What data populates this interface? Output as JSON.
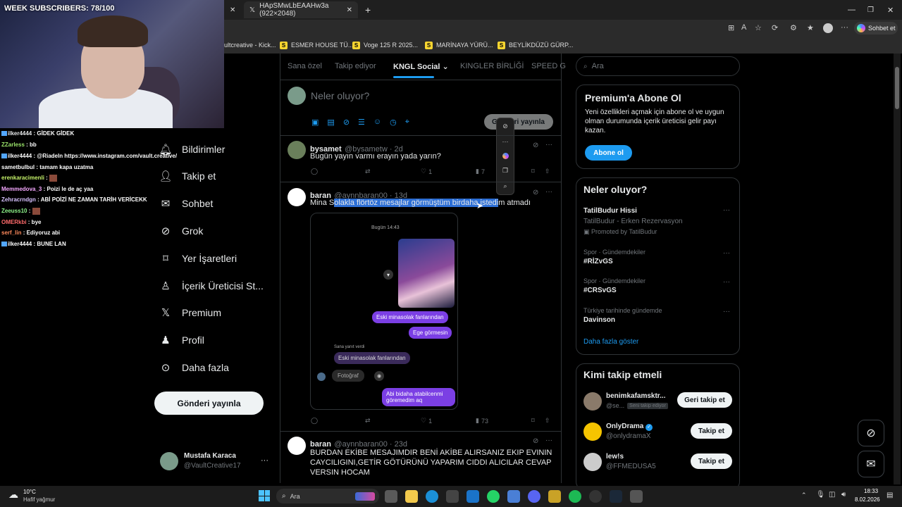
{
  "overlay": {
    "subscribers": "WEEK SUBSCRIBERS: 78/100",
    "chat": [
      {
        "user": "ilker4444",
        "text": ": GİDEK GİDEK",
        "color": "#e7e9ea"
      },
      {
        "user": "ZZarless",
        "text": ": bb",
        "color": "#9be46b"
      },
      {
        "user": "ilker4444",
        "text": ": @Riadeln https://www.instagram.com/vault.creative/",
        "color": "#e7e9ea"
      },
      {
        "user": "sametbulbul",
        "text": ": tamam kapa uzatma",
        "color": "#e7e9ea"
      },
      {
        "user": "erenkaracimenli",
        "text": ":",
        "color": "#c6f36a"
      },
      {
        "user": "Memmedova_3",
        "text": ": Poizi le de aç yaa",
        "color": "#f5a8ff"
      },
      {
        "user": "Zehracrndgn",
        "text": ": ABİ POİZİ NE ZAMAN TARİH VERİCEKK",
        "color": "#d7c2ff"
      },
      {
        "user": "Zeeuss10",
        "text": ":",
        "color": "#8ef58b"
      },
      {
        "user": "OMERkbi",
        "text": ": bye",
        "color": "#ff6b6b"
      },
      {
        "user": "serf_lin",
        "text": ": Ediyoruz abi",
        "color": "#ff8a5c"
      },
      {
        "user": "ilker4444",
        "text": ": BUNE LAN",
        "color": "#e7e9ea"
      }
    ]
  },
  "browser": {
    "tab_active": "HApSMwLbEAAHw3a (922×2048)",
    "bookmarks": [
      "ultcreative - Kick...",
      "ESMER HOUSE TÜ...",
      "Voge 125 R 2025...",
      "MARİNAYA YÜRÜ...",
      "BEYLİKDÜZÜ GÜRP..."
    ],
    "copilot_label": "Sohbet et"
  },
  "nav": {
    "items": [
      {
        "label": "Bildirimler",
        "icon": "bell-icon"
      },
      {
        "label": "Takip et",
        "icon": "person-add-icon"
      },
      {
        "label": "Sohbet",
        "icon": "mail-icon"
      },
      {
        "label": "Grok",
        "icon": "grok-icon"
      },
      {
        "label": "Yer İşaretleri",
        "icon": "bookmark-icon"
      },
      {
        "label": "İçerik Üreticisi St...",
        "icon": "creator-icon"
      },
      {
        "label": "Premium",
        "icon": "x-logo-icon"
      },
      {
        "label": "Profil",
        "icon": "profile-icon"
      },
      {
        "label": "Daha fazla",
        "icon": "more-circle-icon"
      }
    ],
    "post_button": "Gönderi yayınla",
    "account_name": "Mustafa Karaca",
    "account_handle": "@VaultCreative17"
  },
  "feed": {
    "tabs": [
      "Sana özel",
      "Takip ediyor",
      "KNGL Social",
      "KINGLER BİRLİĞİ",
      "SPEED G"
    ],
    "compose_placeholder": "Neler oluyor?",
    "compose_button": "Gönderi yayınla",
    "tweets": [
      {
        "name": "bysamet",
        "handle": "@bysametw · 2d",
        "text": "Bugün yayın varmı erayın yada yarın?",
        "likes": "1",
        "views": "7"
      },
      {
        "name": "baran",
        "handle": "@aynnbaran00 · 13d",
        "text_pre": "Mina S",
        "text_sel": "olakla flörtöz mesajlar görmüştüm birdaha istedi",
        "text_post": "m atmadı",
        "likes": "1",
        "views": "73"
      },
      {
        "name": "baran",
        "handle": "@aynnbaran00 · 23d",
        "text": "BURDAN EKİBE MESAJIMDIR  BENİ AKİBE ALIRSANIZ EKIP EVININ CAYCILIGINI,GETİR GÖTÜRÜNÜ YAPARIM CIDDI ALICILAR CEVAP VERSIN HOCAM"
      }
    ],
    "chat_image": {
      "time": "Bugün 14:43",
      "bubble1": "Eski minasolak fanlarından",
      "bubble2": "Ege görmesin",
      "replied": "Sana yanıt verdi",
      "bubble3": "Eski minasolak fanlarından",
      "photo": "Fotoğraf",
      "bubble4": "Abi bidaha atabilcenmi göremedim aq"
    }
  },
  "sidebar": {
    "search_placeholder": "Ara",
    "premium_title": "Premium'a Abone Ol",
    "premium_text": "Yeni özellikleri açmak için abone ol ve uygun olman durumunda içerik üreticisi gelir payı kazan.",
    "premium_button": "Abone ol",
    "trends_title": "Neler oluyor?",
    "trends": [
      {
        "meta": "",
        "name": "TatilBudur Hissi",
        "sub": "TatilBudur - Erken Rezervasyon",
        "promo": "Promoted by TatilBudur"
      },
      {
        "meta": "Spor · Gündemdekiler",
        "name": "#RİZvGS"
      },
      {
        "meta": "Spor · Gündemdekiler",
        "name": "#CRSvGS"
      },
      {
        "meta": "Türkiye tarihinde gündemde",
        "name": "Davinson"
      }
    ],
    "show_more": "Daha fazla göster",
    "who_title": "Kimi takip etmeli",
    "who": [
      {
        "name": "benimkafamsktr...",
        "handle": "@se...",
        "badge": "Seni takip ediyor",
        "button": "Geri takip et"
      },
      {
        "name": "OnlyDrama",
        "handle": "@onlydramaX",
        "button": "Takip et"
      },
      {
        "name": "lew!s",
        "handle": "@FFMEDUSA5",
        "button": "Takip et"
      }
    ]
  },
  "taskbar": {
    "temp": "10°C",
    "weather": "Hafif yağmur",
    "search": "Ara",
    "time": "18:33",
    "date": "8.02.2026"
  }
}
